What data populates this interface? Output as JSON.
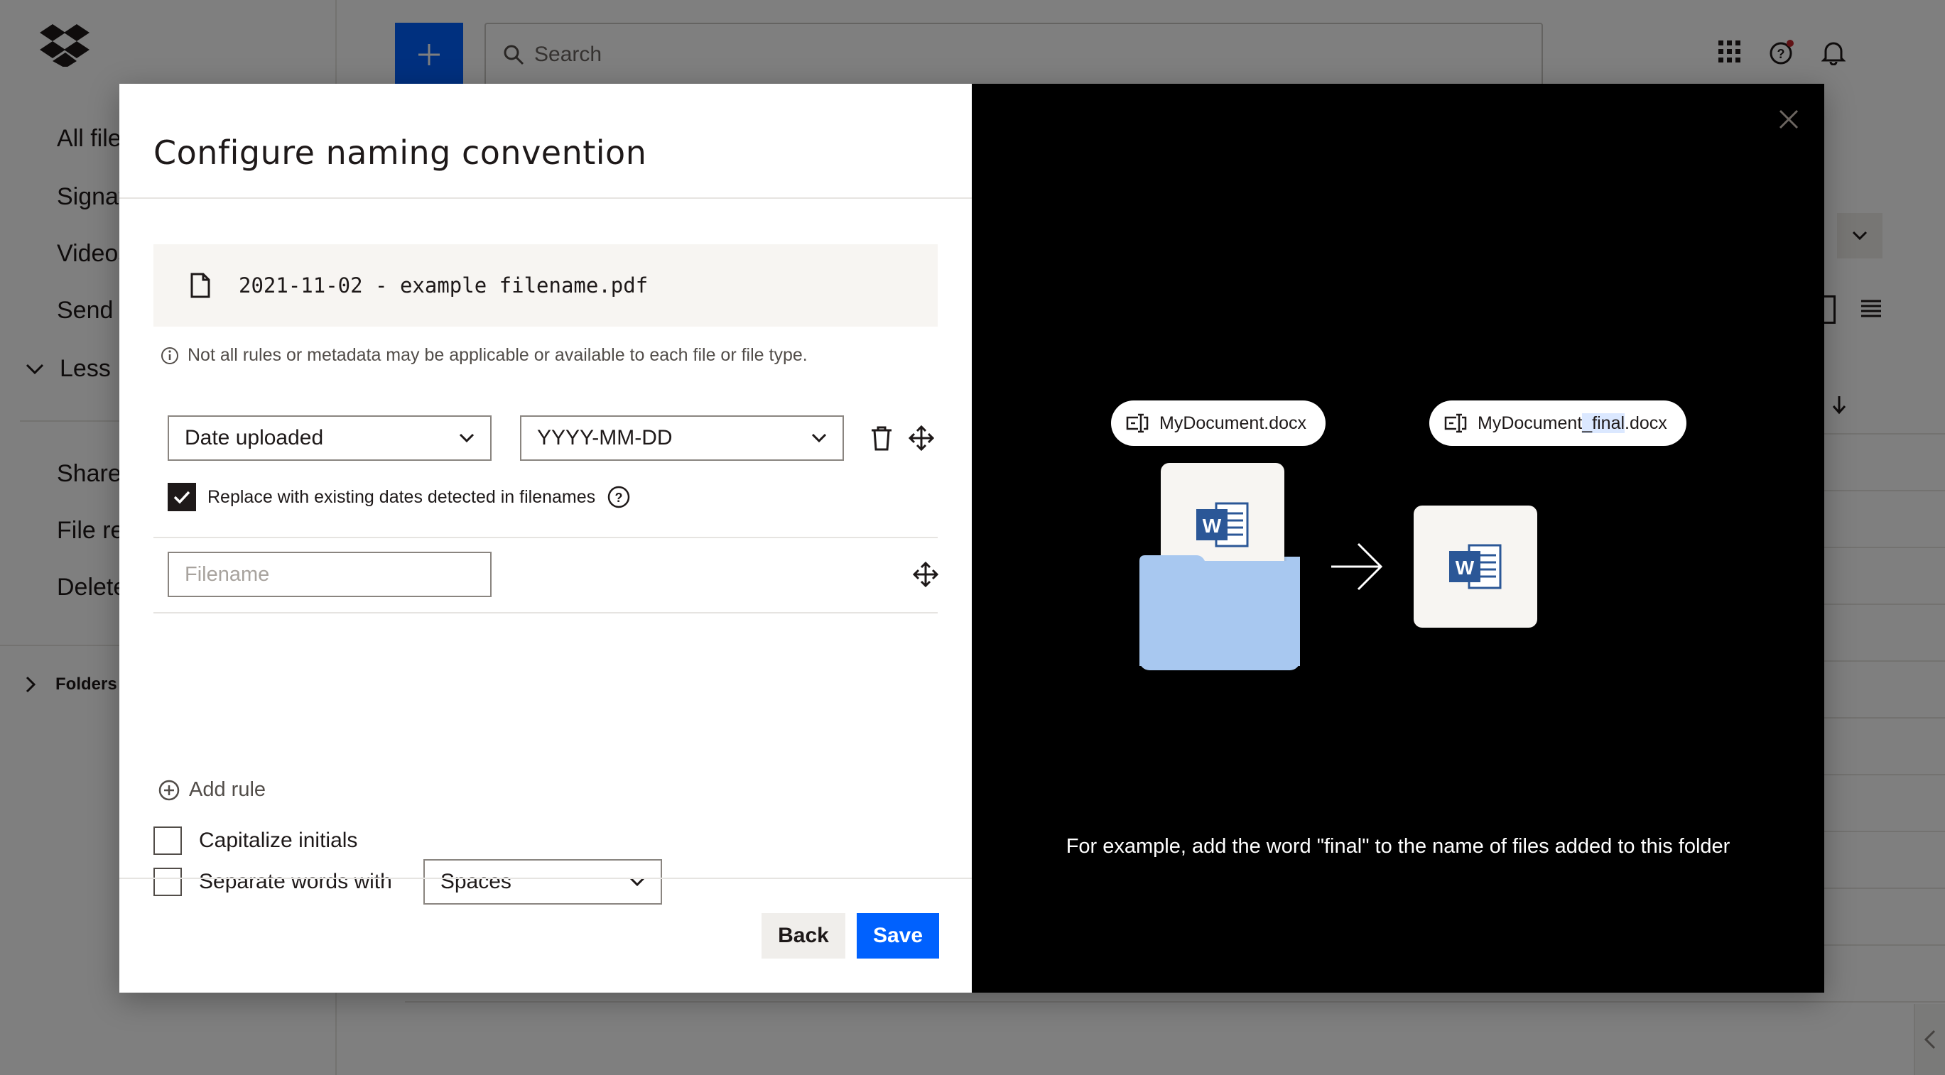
{
  "background": {
    "sidebar": {
      "items": [
        "All files",
        "Signatures",
        "Videos",
        "Send and track",
        "Shared",
        "File requests",
        "Deleted files"
      ],
      "less_label": "Less",
      "folders_label": "Folders"
    },
    "search_placeholder": "Search"
  },
  "dialog": {
    "title": "Configure naming convention",
    "preview_filename": "2021-11-02 - example filename.pdf",
    "info_text": "Not all rules or metadata may be applicable or available to each file or file type.",
    "rule": {
      "type_value": "Date uploaded",
      "format_value": "YYYY-MM-DD"
    },
    "replace_dates_label": "Replace with existing dates detected in filenames",
    "replace_dates_checked": true,
    "filename_placeholder": "Filename",
    "add_rule_label": "Add rule",
    "capitalize_label": "Capitalize initials",
    "capitalize_checked": false,
    "separate_label": "Separate words with",
    "separate_checked": false,
    "separator_value": "Spaces",
    "back_label": "Back",
    "save_label": "Save"
  },
  "illustration": {
    "before_pre": "MyDocument",
    "before_ext": ".docx",
    "after_pre": "MyDocument",
    "after_highlight": "_final",
    "after_ext": ".docx",
    "caption": "For example, add the word \"final\" to the name of files added to this folder"
  },
  "colors": {
    "accent": "#0061fe",
    "folder": "#a8c8f0",
    "word_blue": "#2b5797"
  }
}
